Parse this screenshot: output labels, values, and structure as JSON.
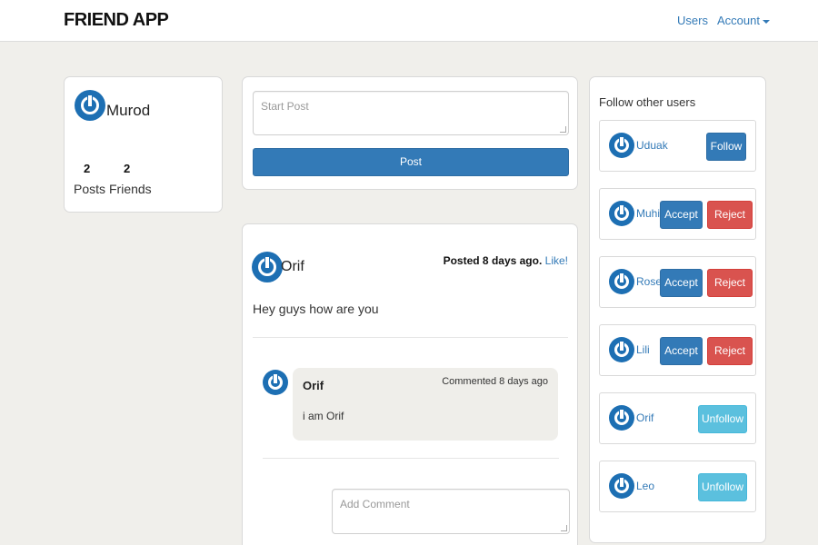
{
  "navbar": {
    "brand": "FRIEND APP",
    "users_link": "Users",
    "account_link": "Account"
  },
  "profile": {
    "name": "Murod",
    "posts_count": "2",
    "posts_label": "Posts",
    "friends_count": "2",
    "friends_label": "Friends"
  },
  "composer": {
    "placeholder": "Start Post",
    "post_button": "Post"
  },
  "post": {
    "author": "Orif",
    "posted_text": "Posted 8 days ago.",
    "like_label": "Like!",
    "body": "Hey guys how are you",
    "comment": {
      "author": "Orif",
      "time": "Commented 8 days ago",
      "text": "i am Orif"
    },
    "comment_placeholder": "Add Comment"
  },
  "sidebar": {
    "title": "Follow other users",
    "users": [
      {
        "name": "Uduak",
        "actions": [
          "Follow"
        ]
      },
      {
        "name": "Muhi",
        "actions": [
          "Accept",
          "Reject"
        ]
      },
      {
        "name": "Rose",
        "actions": [
          "Accept",
          "Reject"
        ]
      },
      {
        "name": "Lili",
        "actions": [
          "Accept",
          "Reject"
        ]
      },
      {
        "name": "Orif",
        "actions": [
          "Unfollow"
        ]
      },
      {
        "name": "Leo",
        "actions": [
          "Unfollow"
        ]
      }
    ]
  },
  "colors": {
    "primary": "#337ab7",
    "danger": "#d9534f",
    "info": "#5bc0de",
    "avatar": "#1d6fb3",
    "background": "#f0efeb"
  },
  "icons": {
    "avatar": "power-icon",
    "dropdown": "caret-down-icon"
  }
}
